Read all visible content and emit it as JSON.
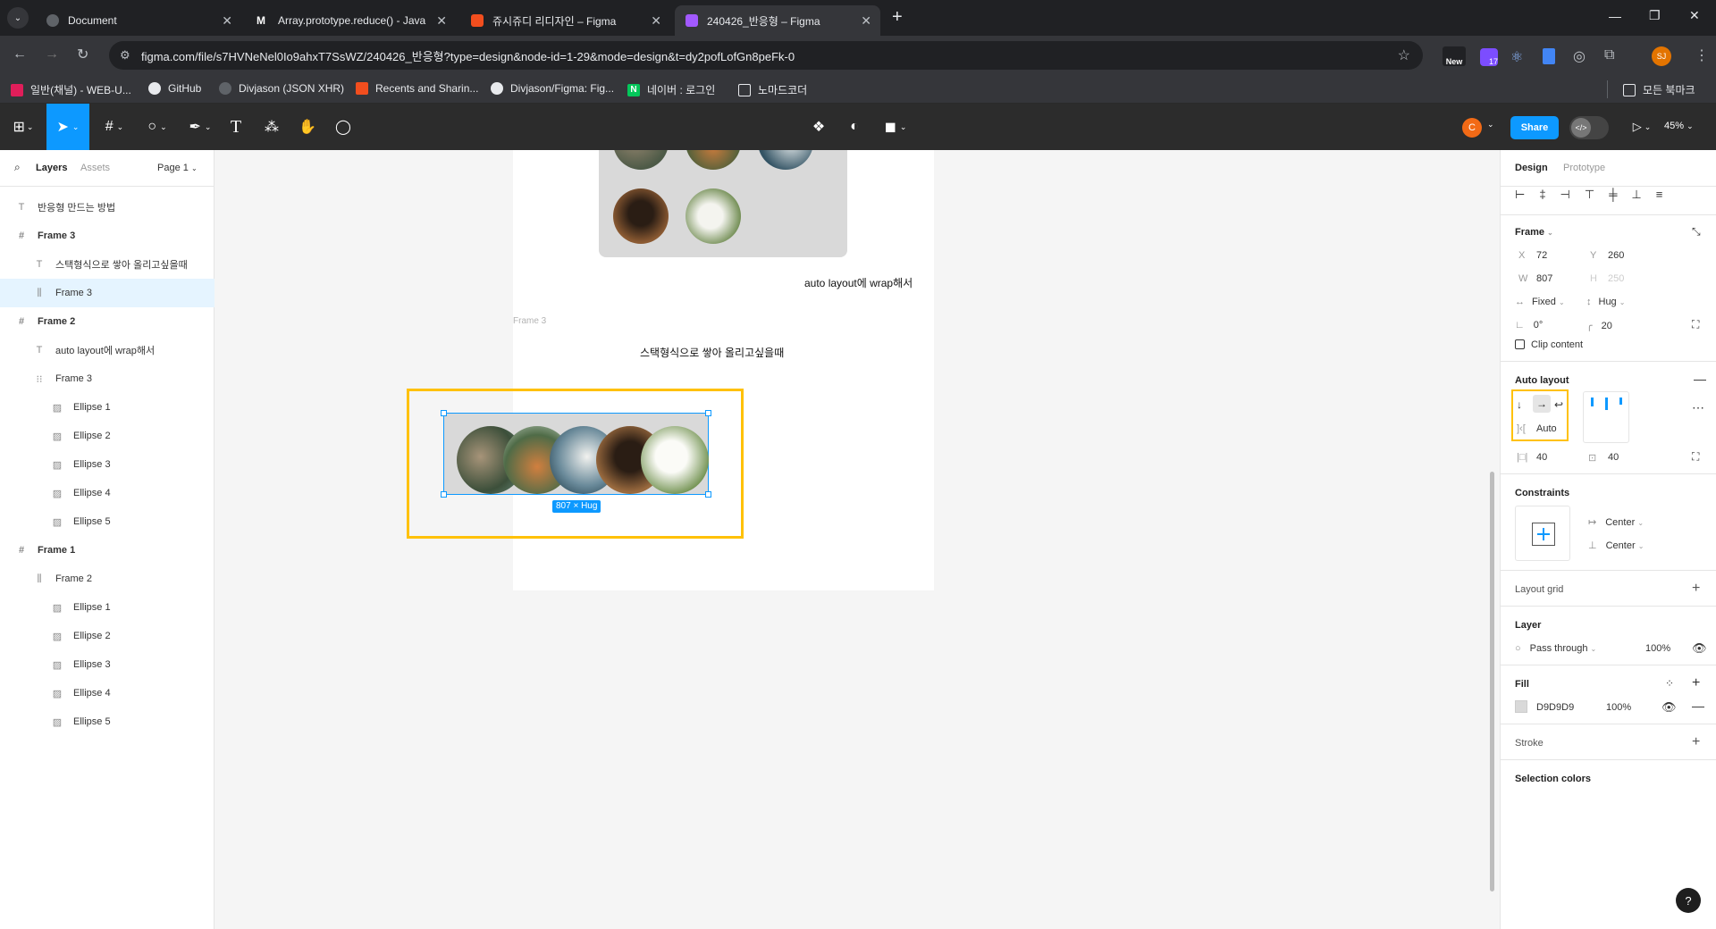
{
  "browser": {
    "tabs": [
      {
        "title": "Document",
        "favicon_color": "#5f6368"
      },
      {
        "title": "Array.prototype.reduce() - Java",
        "favicon_color": "#ffffff"
      },
      {
        "title": "쥬시쥬디 리디자인 – Figma",
        "favicon_color": "#f24e1e"
      },
      {
        "title": "240426_반응형 – Figma",
        "favicon_color": "#a259ff"
      }
    ],
    "url": "figma.com/file/s7HVNeNel0Io9ahxT7SsWZ/240426_반응형?type=design&node-id=1-29&mode=design&t=dy2pofLofGn8peFk-0",
    "extension_badge": "17",
    "new_label": "New",
    "profile_initials": "SJ",
    "bookmarks": [
      "일반(채널) - WEB-U...",
      "GitHub",
      "Divjason (JSON XHR)",
      "Recents and Sharin...",
      "Divjason/Figma: Fig...",
      "네이버 : 로그인",
      "노마드코더"
    ],
    "all_bookmarks": "모든 북마크"
  },
  "toolbar": {
    "user_initial": "C",
    "share_label": "Share",
    "zoom": "45%"
  },
  "left_panel": {
    "tab_layers": "Layers",
    "tab_assets": "Assets",
    "page": "Page 1",
    "layers": [
      {
        "label": "반응형 만드는 방법",
        "icon": "T",
        "indent": 0,
        "bold": false
      },
      {
        "label": "Frame 3",
        "icon": "#",
        "indent": 0,
        "bold": true
      },
      {
        "label": "스택형식으로 쌓아 올리고싶을때",
        "icon": "T",
        "indent": 1,
        "bold": false
      },
      {
        "label": "Frame 3",
        "icon": "⫼",
        "indent": 1,
        "bold": false,
        "selected": true
      },
      {
        "label": "Frame 2",
        "icon": "#",
        "indent": 0,
        "bold": true
      },
      {
        "label": "auto layout에 wrap해서",
        "icon": "T",
        "indent": 1,
        "bold": false
      },
      {
        "label": "Frame 3",
        "icon": "⁝⁝",
        "indent": 1,
        "bold": false
      },
      {
        "label": "Ellipse 1",
        "icon": "▨",
        "indent": 2,
        "bold": false
      },
      {
        "label": "Ellipse 2",
        "icon": "▨",
        "indent": 2,
        "bold": false
      },
      {
        "label": "Ellipse 3",
        "icon": "▨",
        "indent": 2,
        "bold": false
      },
      {
        "label": "Ellipse 4",
        "icon": "▨",
        "indent": 2,
        "bold": false
      },
      {
        "label": "Ellipse 5",
        "icon": "▨",
        "indent": 2,
        "bold": false
      },
      {
        "label": "Frame 1",
        "icon": "#",
        "indent": 0,
        "bold": true
      },
      {
        "label": "Frame 2",
        "icon": "⫼",
        "indent": 1,
        "bold": false
      },
      {
        "label": "Ellipse 1",
        "icon": "▨",
        "indent": 2,
        "bold": false
      },
      {
        "label": "Ellipse 2",
        "icon": "▨",
        "indent": 2,
        "bold": false
      },
      {
        "label": "Ellipse 3",
        "icon": "▨",
        "indent": 2,
        "bold": false
      },
      {
        "label": "Ellipse 4",
        "icon": "▨",
        "indent": 2,
        "bold": false
      },
      {
        "label": "Ellipse 5",
        "icon": "▨",
        "indent": 2,
        "bold": false
      }
    ]
  },
  "canvas": {
    "frame2_text": "auto layout에 wrap해서",
    "frame3_label": "Frame 3",
    "frame3_text": "스택형식으로 쌓아 올리고싶을때",
    "size_badge": "807 × Hug",
    "highlight_color": "#ffc107",
    "selection_color": "#0d99ff"
  },
  "right_panel": {
    "tab_design": "Design",
    "tab_prototype": "Prototype",
    "frame_label": "Frame",
    "x_label": "X",
    "x": "72",
    "y_label": "Y",
    "y": "260",
    "w_label": "W",
    "w": "807",
    "h_label": "H",
    "h": "250",
    "width_mode": "Fixed",
    "height_mode": "Hug",
    "rotation": "0°",
    "radius": "20",
    "clip_content": "Clip content",
    "auto_layout": "Auto layout",
    "gap": "Auto",
    "pad_h": "40",
    "pad_v": "40",
    "constraints": "Constraints",
    "constraint_h": "Center",
    "constraint_v": "Center",
    "layout_grid": "Layout grid",
    "layer": "Layer",
    "blend": "Pass through",
    "opacity": "100%",
    "fill": "Fill",
    "fill_hex": "D9D9D9",
    "fill_opacity": "100%",
    "stroke": "Stroke",
    "selection_colors": "Selection colors",
    "help": "?"
  }
}
